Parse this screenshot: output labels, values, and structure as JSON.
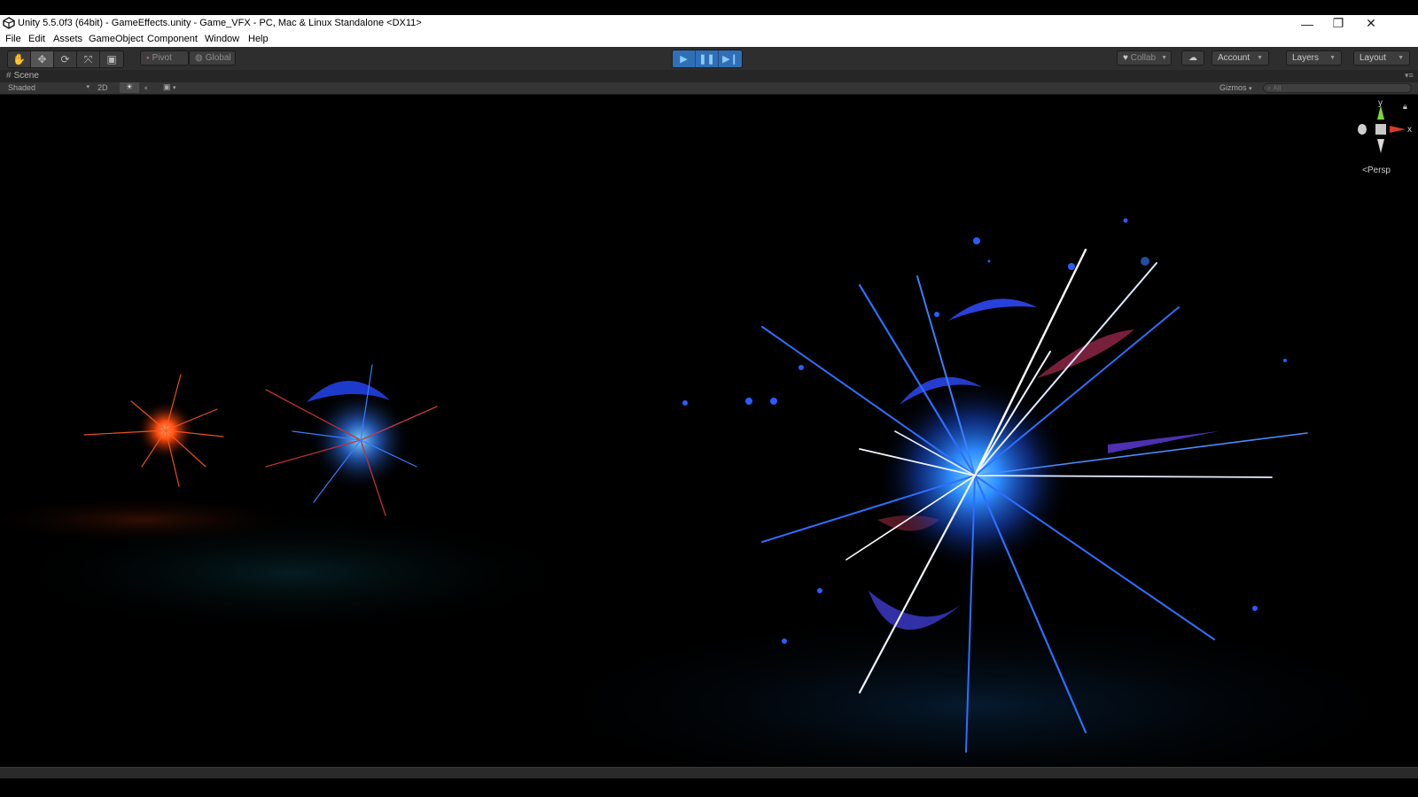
{
  "window": {
    "title": "Unity 5.5.0f3 (64bit) - GameEffects.unity - Game_VFX - PC, Mac & Linux Standalone <DX11>",
    "minimize": "—",
    "restore": "❐",
    "close": "✕"
  },
  "menu": [
    "File",
    "Edit",
    "Assets",
    "GameObject",
    "Component",
    "Window",
    "Help"
  ],
  "toolbar": {
    "pivot": "Pivot",
    "global": "Global",
    "collab": "Collab",
    "account": "Account",
    "layers": "Layers",
    "layout": "Layout"
  },
  "scene": {
    "tab": "Scene",
    "shading": "Shaded",
    "mode_2d": "2D",
    "gizmos": "Gizmos",
    "search_placeholder": "All"
  },
  "gizmo": {
    "y": "y",
    "x": "x",
    "projection": "Persp"
  },
  "colors": {
    "play_accent": "#2f6fb5",
    "toolbar_bg": "#2e2e2e",
    "viewport_bg": "#000000"
  }
}
